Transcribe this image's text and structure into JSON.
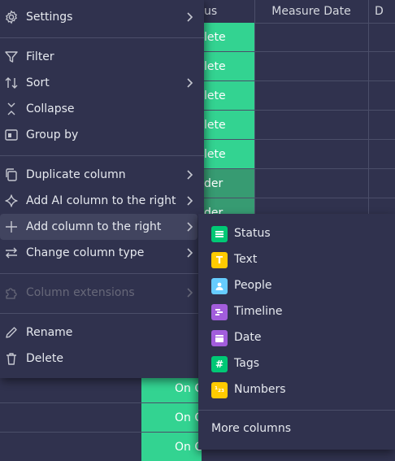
{
  "board": {
    "columns": {
      "status": "us",
      "measure_date": "Measure Date",
      "next": "D"
    },
    "status_cells": [
      "lete",
      "lete",
      "lete",
      "lete",
      "lete",
      "der",
      "der"
    ],
    "bottom_cells": [
      "On C",
      "On C",
      "On C"
    ]
  },
  "menu": {
    "items": [
      {
        "label": "Settings",
        "icon": "gear-icon"
      },
      {
        "label": "Filter",
        "icon": "filter-icon"
      },
      {
        "label": "Sort",
        "icon": "sort-icon"
      },
      {
        "label": "Collapse",
        "icon": "collapse-icon"
      },
      {
        "label": "Group by",
        "icon": "group-by-icon"
      },
      {
        "label": "Duplicate column",
        "icon": "duplicate-icon"
      },
      {
        "label": "Add AI column to the right",
        "icon": "ai-sparkle-icon"
      },
      {
        "label": "Add column to the right",
        "icon": "plus-icon"
      },
      {
        "label": "Change column type",
        "icon": "swap-arrows-icon"
      },
      {
        "label": "Column extensions",
        "icon": "puzzle-icon"
      },
      {
        "label": "Rename",
        "icon": "pencil-icon"
      },
      {
        "label": "Delete",
        "icon": "trash-icon"
      }
    ]
  },
  "submenu": {
    "items": [
      {
        "label": "Status",
        "icon": "status-icon",
        "color": "#00c875"
      },
      {
        "label": "Text",
        "icon": "text-icon",
        "color": "#ffcb00"
      },
      {
        "label": "People",
        "icon": "people-icon",
        "color": "#66ccff"
      },
      {
        "label": "Timeline",
        "icon": "timeline-icon",
        "color": "#a25ddc"
      },
      {
        "label": "Date",
        "icon": "date-icon",
        "color": "#a25ddc"
      },
      {
        "label": "Tags",
        "icon": "tags-icon",
        "color": "#00c875"
      },
      {
        "label": "Numbers",
        "icon": "numbers-icon",
        "color": "#ffcb00"
      }
    ],
    "more": "More columns",
    "glyphs": {
      "text": "T",
      "tags": "#",
      "numbers": "¹₂₃"
    }
  },
  "colors": {
    "background": "#30324e",
    "done": "#33d391",
    "working": "#379b72",
    "hover": "#41445f"
  }
}
